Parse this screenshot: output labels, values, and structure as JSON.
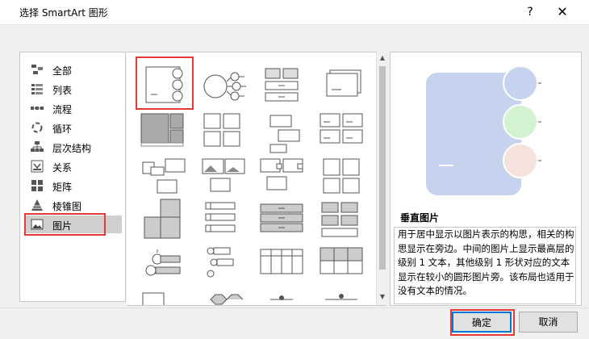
{
  "window": {
    "title": "选择 SmartArt 图形",
    "help": "?",
    "close": "✕"
  },
  "sidebar": {
    "items": [
      {
        "label": "全部",
        "icon": "all-icon"
      },
      {
        "label": "列表",
        "icon": "list-icon"
      },
      {
        "label": "流程",
        "icon": "process-icon"
      },
      {
        "label": "循环",
        "icon": "cycle-icon"
      },
      {
        "label": "层次结构",
        "icon": "hierarchy-icon"
      },
      {
        "label": "关系",
        "icon": "relationship-icon"
      },
      {
        "label": "矩阵",
        "icon": "matrix-icon"
      },
      {
        "label": "棱锥图",
        "icon": "pyramid-icon"
      },
      {
        "label": "图片",
        "icon": "picture-icon",
        "selected": true
      }
    ]
  },
  "preview": {
    "title": "垂直图片",
    "description": "用于居中显示以图片表示的构思，相关的构思显示在旁边。中间的图片上显示最高层的级别 1 文本，其他级别 1 形状对应的文本显示在较小的圆形图片旁。该布局也适用于没有文本的情况。"
  },
  "buttons": {
    "ok": "确定",
    "cancel": "取消"
  },
  "colors": {
    "preview_main": "#c5d3ee",
    "circle_blue": "#c5d3ee",
    "circle_green": "#d3f2d2",
    "circle_pink": "#f6e2dc",
    "highlight": "#e53935",
    "accent": "#0078d7"
  }
}
